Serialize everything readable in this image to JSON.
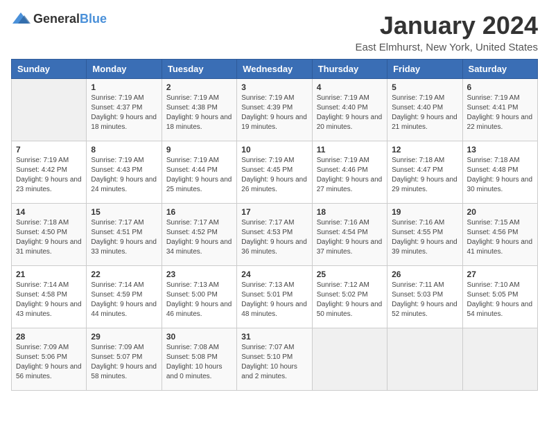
{
  "logo": {
    "general": "General",
    "blue": "Blue"
  },
  "header": {
    "title": "January 2024",
    "subtitle": "East Elmhurst, New York, United States"
  },
  "weekdays": [
    "Sunday",
    "Monday",
    "Tuesday",
    "Wednesday",
    "Thursday",
    "Friday",
    "Saturday"
  ],
  "weeks": [
    [
      {
        "day": "",
        "sunrise": "",
        "sunset": "",
        "daylight": ""
      },
      {
        "day": "1",
        "sunrise": "Sunrise: 7:19 AM",
        "sunset": "Sunset: 4:37 PM",
        "daylight": "Daylight: 9 hours and 18 minutes."
      },
      {
        "day": "2",
        "sunrise": "Sunrise: 7:19 AM",
        "sunset": "Sunset: 4:38 PM",
        "daylight": "Daylight: 9 hours and 18 minutes."
      },
      {
        "day": "3",
        "sunrise": "Sunrise: 7:19 AM",
        "sunset": "Sunset: 4:39 PM",
        "daylight": "Daylight: 9 hours and 19 minutes."
      },
      {
        "day": "4",
        "sunrise": "Sunrise: 7:19 AM",
        "sunset": "Sunset: 4:40 PM",
        "daylight": "Daylight: 9 hours and 20 minutes."
      },
      {
        "day": "5",
        "sunrise": "Sunrise: 7:19 AM",
        "sunset": "Sunset: 4:40 PM",
        "daylight": "Daylight: 9 hours and 21 minutes."
      },
      {
        "day": "6",
        "sunrise": "Sunrise: 7:19 AM",
        "sunset": "Sunset: 4:41 PM",
        "daylight": "Daylight: 9 hours and 22 minutes."
      }
    ],
    [
      {
        "day": "7",
        "sunrise": "Sunrise: 7:19 AM",
        "sunset": "Sunset: 4:42 PM",
        "daylight": "Daylight: 9 hours and 23 minutes."
      },
      {
        "day": "8",
        "sunrise": "Sunrise: 7:19 AM",
        "sunset": "Sunset: 4:43 PM",
        "daylight": "Daylight: 9 hours and 24 minutes."
      },
      {
        "day": "9",
        "sunrise": "Sunrise: 7:19 AM",
        "sunset": "Sunset: 4:44 PM",
        "daylight": "Daylight: 9 hours and 25 minutes."
      },
      {
        "day": "10",
        "sunrise": "Sunrise: 7:19 AM",
        "sunset": "Sunset: 4:45 PM",
        "daylight": "Daylight: 9 hours and 26 minutes."
      },
      {
        "day": "11",
        "sunrise": "Sunrise: 7:19 AM",
        "sunset": "Sunset: 4:46 PM",
        "daylight": "Daylight: 9 hours and 27 minutes."
      },
      {
        "day": "12",
        "sunrise": "Sunrise: 7:18 AM",
        "sunset": "Sunset: 4:47 PM",
        "daylight": "Daylight: 9 hours and 29 minutes."
      },
      {
        "day": "13",
        "sunrise": "Sunrise: 7:18 AM",
        "sunset": "Sunset: 4:48 PM",
        "daylight": "Daylight: 9 hours and 30 minutes."
      }
    ],
    [
      {
        "day": "14",
        "sunrise": "Sunrise: 7:18 AM",
        "sunset": "Sunset: 4:50 PM",
        "daylight": "Daylight: 9 hours and 31 minutes."
      },
      {
        "day": "15",
        "sunrise": "Sunrise: 7:17 AM",
        "sunset": "Sunset: 4:51 PM",
        "daylight": "Daylight: 9 hours and 33 minutes."
      },
      {
        "day": "16",
        "sunrise": "Sunrise: 7:17 AM",
        "sunset": "Sunset: 4:52 PM",
        "daylight": "Daylight: 9 hours and 34 minutes."
      },
      {
        "day": "17",
        "sunrise": "Sunrise: 7:17 AM",
        "sunset": "Sunset: 4:53 PM",
        "daylight": "Daylight: 9 hours and 36 minutes."
      },
      {
        "day": "18",
        "sunrise": "Sunrise: 7:16 AM",
        "sunset": "Sunset: 4:54 PM",
        "daylight": "Daylight: 9 hours and 37 minutes."
      },
      {
        "day": "19",
        "sunrise": "Sunrise: 7:16 AM",
        "sunset": "Sunset: 4:55 PM",
        "daylight": "Daylight: 9 hours and 39 minutes."
      },
      {
        "day": "20",
        "sunrise": "Sunrise: 7:15 AM",
        "sunset": "Sunset: 4:56 PM",
        "daylight": "Daylight: 9 hours and 41 minutes."
      }
    ],
    [
      {
        "day": "21",
        "sunrise": "Sunrise: 7:14 AM",
        "sunset": "Sunset: 4:58 PM",
        "daylight": "Daylight: 9 hours and 43 minutes."
      },
      {
        "day": "22",
        "sunrise": "Sunrise: 7:14 AM",
        "sunset": "Sunset: 4:59 PM",
        "daylight": "Daylight: 9 hours and 44 minutes."
      },
      {
        "day": "23",
        "sunrise": "Sunrise: 7:13 AM",
        "sunset": "Sunset: 5:00 PM",
        "daylight": "Daylight: 9 hours and 46 minutes."
      },
      {
        "day": "24",
        "sunrise": "Sunrise: 7:13 AM",
        "sunset": "Sunset: 5:01 PM",
        "daylight": "Daylight: 9 hours and 48 minutes."
      },
      {
        "day": "25",
        "sunrise": "Sunrise: 7:12 AM",
        "sunset": "Sunset: 5:02 PM",
        "daylight": "Daylight: 9 hours and 50 minutes."
      },
      {
        "day": "26",
        "sunrise": "Sunrise: 7:11 AM",
        "sunset": "Sunset: 5:03 PM",
        "daylight": "Daylight: 9 hours and 52 minutes."
      },
      {
        "day": "27",
        "sunrise": "Sunrise: 7:10 AM",
        "sunset": "Sunset: 5:05 PM",
        "daylight": "Daylight: 9 hours and 54 minutes."
      }
    ],
    [
      {
        "day": "28",
        "sunrise": "Sunrise: 7:09 AM",
        "sunset": "Sunset: 5:06 PM",
        "daylight": "Daylight: 9 hours and 56 minutes."
      },
      {
        "day": "29",
        "sunrise": "Sunrise: 7:09 AM",
        "sunset": "Sunset: 5:07 PM",
        "daylight": "Daylight: 9 hours and 58 minutes."
      },
      {
        "day": "30",
        "sunrise": "Sunrise: 7:08 AM",
        "sunset": "Sunset: 5:08 PM",
        "daylight": "Daylight: 10 hours and 0 minutes."
      },
      {
        "day": "31",
        "sunrise": "Sunrise: 7:07 AM",
        "sunset": "Sunset: 5:10 PM",
        "daylight": "Daylight: 10 hours and 2 minutes."
      },
      {
        "day": "",
        "sunrise": "",
        "sunset": "",
        "daylight": ""
      },
      {
        "day": "",
        "sunrise": "",
        "sunset": "",
        "daylight": ""
      },
      {
        "day": "",
        "sunrise": "",
        "sunset": "",
        "daylight": ""
      }
    ]
  ]
}
